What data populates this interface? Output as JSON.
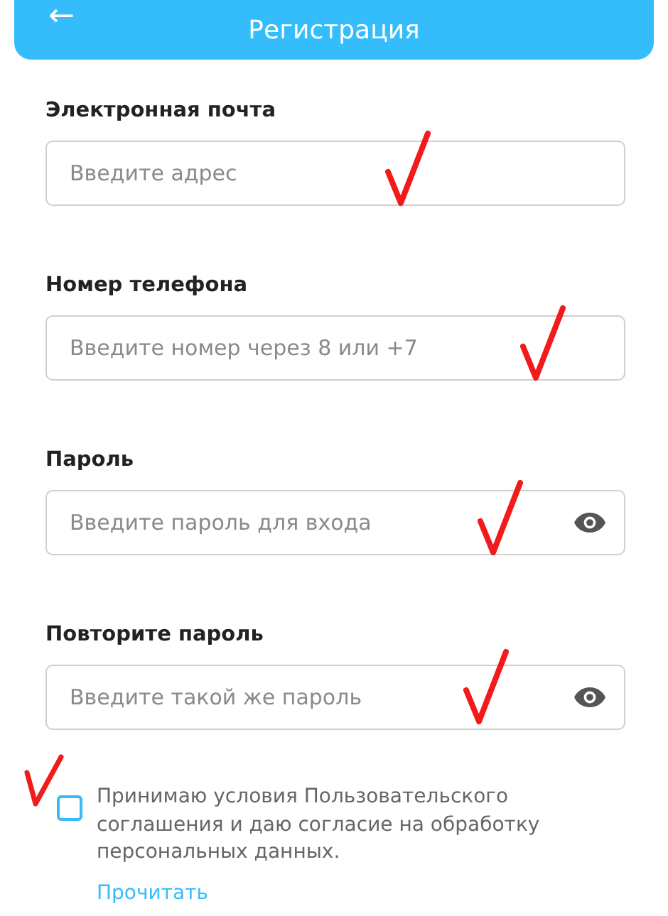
{
  "header": {
    "back": "←",
    "title": "Регистрация"
  },
  "fields": [
    {
      "label": "Электронная почта",
      "placeholder": "Введите адрес",
      "kind": "text"
    },
    {
      "label": "Номер телефона",
      "placeholder": "Введите номер через 8 или +7",
      "kind": "text"
    },
    {
      "label": "Пароль",
      "placeholder": "Введите пароль для входа",
      "kind": "password"
    },
    {
      "label": "Повторите пароль",
      "placeholder": "Введите такой же пароль",
      "kind": "password"
    }
  ],
  "agreement": {
    "checked": false,
    "text": "Принимаю условия Пользовательского соглашения и даю согласие на обработку персональных данных.",
    "link": "Прочитать"
  }
}
